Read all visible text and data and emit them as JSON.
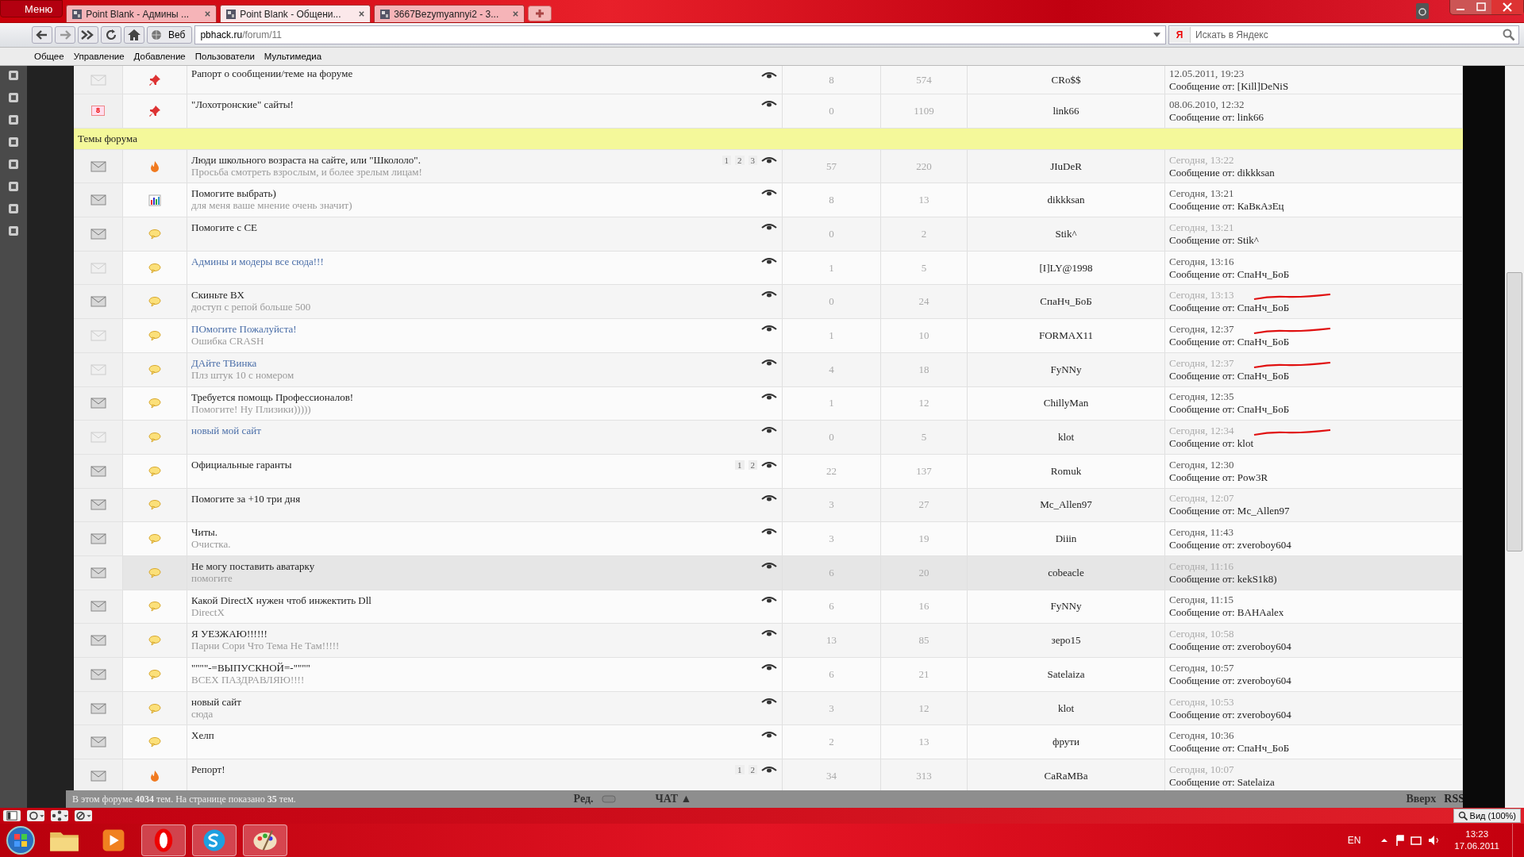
{
  "browser": {
    "menu_label": "Меню",
    "tabs": [
      {
        "title": "Point Blank - Админы ...",
        "selected": false
      },
      {
        "title": "Point Blank - Общени...",
        "selected": true
      },
      {
        "title": "3667Bezymyannyi2 - 3...",
        "selected": false
      }
    ],
    "nav_mode": "Веб",
    "url_host": "pbhack.ru",
    "url_path": "/forum/11",
    "search_placeholder": "Искать в Яндекс",
    "search_engine": "Я",
    "menu": [
      "Общее",
      "Управление",
      "Добавление",
      "Пользователи",
      "Мультимедиа"
    ]
  },
  "pinned": [
    {
      "kind": "pin",
      "title": "Рапорт о сообщении/теме на форуме",
      "visited": false,
      "replies": "8",
      "views": "574",
      "author": "CRo$$",
      "last_date": "12.05.2011, 19:23",
      "last_post": "Сообщение от: [Kill]DeNiS"
    },
    {
      "badge": "8",
      "kind": "pin",
      "title": "\"Лохотронские\" сайты!",
      "visited": false,
      "replies": "0",
      "views": "1109",
      "author": "link66",
      "last_date": "08.06.2010, 12:32",
      "last_post": "Сообщение от: link66"
    }
  ],
  "section_title": "Темы форума",
  "topics": [
    {
      "unread": true,
      "kind": "hot",
      "title": "Люди школьного возраста на сайте, или \"Школоло\".",
      "subtitle": "Просьба смотреть взрослым, и более зрелым лицам!",
      "visited": false,
      "pages": [
        "1",
        "2",
        "3"
      ],
      "replies": "57",
      "views": "220",
      "author": "JIuDeR",
      "last_date": "Сегодня, 13:22",
      "last_post": "Сообщение от: dikkksan",
      "scribble": false,
      "highlighted": false
    },
    {
      "unread": true,
      "kind": "poll",
      "title": "Помогите выбрать)",
      "subtitle": "для меня ваше мнение очень значит)",
      "visited": false,
      "replies": "8",
      "views": "13",
      "author": "dikkksan",
      "last_date": "Сегодня, 13:21",
      "last_post": "Сообщение от: КаВкАзЕц",
      "scribble": false,
      "highlighted": false
    },
    {
      "unread": true,
      "kind": "normal",
      "title": "Помогите с СЕ",
      "visited": false,
      "replies": "0",
      "views": "2",
      "author": "Stik^",
      "last_date": "Сегодня, 13:21",
      "last_post": "Сообщение от: Stik^",
      "scribble": false,
      "highlighted": false
    },
    {
      "unread": false,
      "kind": "normal",
      "title": "Админы и модеры все сюда!!!",
      "visited": true,
      "replies": "1",
      "views": "5",
      "author": "[I]LY@1998",
      "last_date": "Сегодня, 13:16",
      "last_post": "Сообщение от: СпаНч_БоБ",
      "scribble": false,
      "highlighted": false
    },
    {
      "unread": true,
      "kind": "normal",
      "title": "Скиньте ВХ",
      "subtitle": "доступ с репой больше 500",
      "visited": false,
      "replies": "0",
      "views": "24",
      "author": "СпаНч_БоБ",
      "last_date": "Сегодня, 13:13",
      "last_post": "Сообщение от: СпаНч_БоБ",
      "scribble": true,
      "highlighted": false
    },
    {
      "unread": false,
      "kind": "normal",
      "title": "ПОмогите Пожалуйста!",
      "subtitle": "Ошибка CRASH",
      "visited": true,
      "replies": "1",
      "views": "10",
      "author": "FORMAX11",
      "last_date": "Сегодня, 12:37",
      "last_post": "Сообщение от: СпаНч_БоБ",
      "scribble": true,
      "highlighted": false
    },
    {
      "unread": false,
      "kind": "normal",
      "title": "ДАйте ТВинка",
      "subtitle": "Плз штук 10 с номером",
      "visited": true,
      "replies": "4",
      "views": "18",
      "author": "FyNNy",
      "last_date": "Сегодня, 12:37",
      "last_post": "Сообщение от: СпаНч_БоБ",
      "scribble": true,
      "highlighted": false
    },
    {
      "unread": true,
      "kind": "normal",
      "title": "Требуется помощь Профессионалов!",
      "subtitle": "Помогите! Ну Плизики)))))",
      "visited": false,
      "replies": "1",
      "views": "12",
      "author": "ChillyMan",
      "last_date": "Сегодня, 12:35",
      "last_post": "Сообщение от: СпаНч_БоБ",
      "scribble": false,
      "highlighted": false
    },
    {
      "unread": false,
      "kind": "normal",
      "title": "новый мой сайт",
      "visited": true,
      "replies": "0",
      "views": "5",
      "author": "klot",
      "last_date": "Сегодня, 12:34",
      "last_post": "Сообщение от: klot",
      "scribble": true,
      "highlighted": false
    },
    {
      "unread": true,
      "kind": "normal",
      "title": "Официальные гаранты",
      "visited": false,
      "pages": [
        "1",
        "2"
      ],
      "replies": "22",
      "views": "137",
      "author": "Romuk",
      "last_date": "Сегодня, 12:30",
      "last_post": "Сообщение от: Pow3R",
      "scribble": false,
      "highlighted": false
    },
    {
      "unread": true,
      "kind": "normal",
      "title": "Помогите за +10 три дня",
      "visited": false,
      "replies": "3",
      "views": "27",
      "author": "Mc_Allen97",
      "last_date": "Сегодня, 12:07",
      "last_post": "Сообщение от: Mc_Allen97",
      "scribble": false,
      "highlighted": false
    },
    {
      "unread": true,
      "kind": "normal",
      "title": "Читы.",
      "subtitle": "Очистка.",
      "visited": false,
      "replies": "3",
      "views": "19",
      "author": "Diiin",
      "last_date": "Сегодня, 11:43",
      "last_post": "Сообщение от: zveroboy604",
      "scribble": false,
      "highlighted": false
    },
    {
      "unread": true,
      "kind": "normal",
      "title": "Не могу поставить аватарку",
      "subtitle": "помогите",
      "visited": false,
      "replies": "6",
      "views": "20",
      "author": "cobeacle",
      "last_date": "Сегодня, 11:16",
      "last_post": "Сообщение от: kekS1k8)",
      "scribble": false,
      "highlighted": true
    },
    {
      "unread": true,
      "kind": "normal",
      "title": "Какой DirectX нужен чтоб инжектить Dll",
      "subtitle": "DirectX",
      "visited": false,
      "replies": "6",
      "views": "16",
      "author": "FyNNy",
      "last_date": "Сегодня, 11:15",
      "last_post": "Сообщение от: BAHAalex",
      "scribble": false,
      "highlighted": false
    },
    {
      "unread": true,
      "kind": "normal",
      "title": "Я УЕЗЖАЮ!!!!!!",
      "subtitle": "Парни Сори Что Тема Не Там!!!!!",
      "visited": false,
      "replies": "13",
      "views": "85",
      "author": "зеро15",
      "last_date": "Сегодня, 10:58",
      "last_post": "Сообщение от: zveroboy604",
      "scribble": false,
      "highlighted": false
    },
    {
      "unread": true,
      "kind": "normal",
      "title": "\"\"\"\"-=ВЫПУСКНОЙ=-\"\"\"\"",
      "subtitle": "ВСЕХ ПАЗДРАВЛЯЮ!!!!",
      "visited": false,
      "replies": "6",
      "views": "21",
      "author": "Satelaiza",
      "last_date": "Сегодня, 10:57",
      "last_post": "Сообщение от: zveroboy604",
      "scribble": false,
      "highlighted": false
    },
    {
      "unread": true,
      "kind": "normal",
      "title": "новый сайт",
      "subtitle": "сюда",
      "visited": false,
      "replies": "3",
      "views": "12",
      "author": "klot",
      "last_date": "Сегодня, 10:53",
      "last_post": "Сообщение от: zveroboy604",
      "scribble": false,
      "highlighted": false
    },
    {
      "unread": true,
      "kind": "normal",
      "title": "Хелп",
      "visited": false,
      "replies": "2",
      "views": "13",
      "author": "фрути",
      "last_date": "Сегодня, 10:36",
      "last_post": "Сообщение от: СпаНч_БоБ",
      "scribble": false,
      "highlighted": false
    },
    {
      "unread": true,
      "kind": "hot",
      "title": "Репорт!",
      "visited": false,
      "pages": [
        "1",
        "2"
      ],
      "replies": "34",
      "views": "313",
      "author": "CaRaMBa",
      "last_date": "Сегодня, 10:07",
      "last_post": "Сообщение от: Satelaiza",
      "scribble": false,
      "highlighted": false
    }
  ],
  "footer": {
    "summary": "В этом форуме **4034** тем. На странице показано **35** тем.",
    "edit": "Ред.",
    "chat": "ЧАТ ▲",
    "top": "Вверх",
    "rss": "RSS"
  },
  "status_bar": {
    "zoom": "Вид (100%)"
  },
  "taskbar": {
    "lang": "EN",
    "time": "13:23",
    "date": "17.06.2011"
  }
}
